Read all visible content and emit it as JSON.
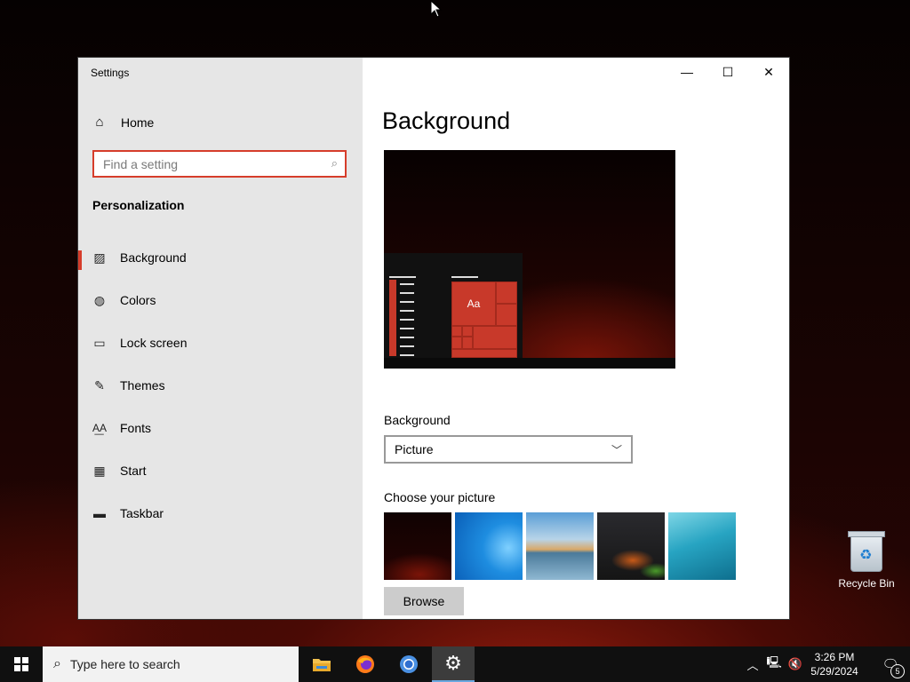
{
  "window": {
    "title": "Settings",
    "minimize_icon": "—",
    "maximize_icon": "☐",
    "close_icon": "✕"
  },
  "sidebar": {
    "home_label": "Home",
    "search_placeholder": "Find a setting",
    "section_title": "Personalization",
    "items": [
      {
        "label": "Background",
        "icon": "picture-icon",
        "active": true
      },
      {
        "label": "Colors",
        "icon": "palette-icon",
        "active": false
      },
      {
        "label": "Lock screen",
        "icon": "lock-screen-icon",
        "active": false
      },
      {
        "label": "Themes",
        "icon": "themes-icon",
        "active": false
      },
      {
        "label": "Fonts",
        "icon": "fonts-icon",
        "active": false
      },
      {
        "label": "Start",
        "icon": "start-icon",
        "active": false
      },
      {
        "label": "Taskbar",
        "icon": "taskbar-icon",
        "active": false
      }
    ]
  },
  "main": {
    "title": "Background",
    "preview_tile_text": "Aa",
    "background_label": "Background",
    "background_value": "Picture",
    "choose_label": "Choose your picture",
    "browse_label": "Browse"
  },
  "desktop": {
    "recycle_bin_label": "Recycle Bin"
  },
  "taskbar": {
    "search_placeholder": "Type here to search",
    "time": "3:26 PM",
    "date": "5/29/2024",
    "notification_count": "5"
  },
  "colors": {
    "accent": "#d63d2b",
    "sidebar_bg": "#e6e6e6",
    "taskbar_bg": "#101010"
  }
}
